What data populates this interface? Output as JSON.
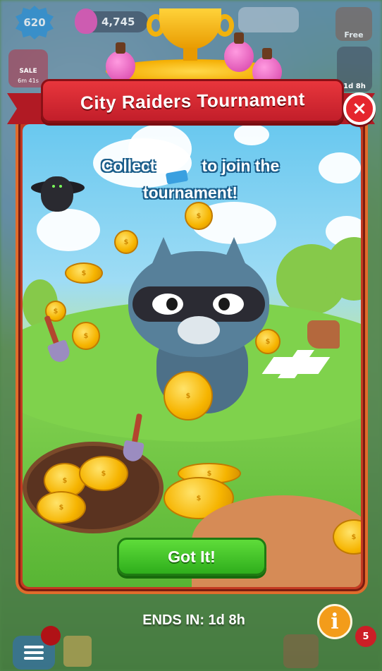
{
  "hud": {
    "level": "620",
    "potions": "4,745",
    "free_label": "Free",
    "sale_label": "SALE",
    "sale_timer": "6m 41s",
    "shovel_timer": "1d 8h"
  },
  "modal": {
    "title": "City Raiders Tournament",
    "close_icon": "×",
    "prompt_part1": "Collect",
    "prompt_part2": "to join the",
    "prompt_part3": "tournament!",
    "button_label": "Got It!",
    "ends_label": "ENDS IN: 1d 8h",
    "info_icon": "i"
  },
  "bottom": {
    "badge_count": "5"
  },
  "colors": {
    "banner": "#e8363c",
    "button": "#3fc225",
    "frame": "#c33a22",
    "info": "#f39c1a"
  }
}
